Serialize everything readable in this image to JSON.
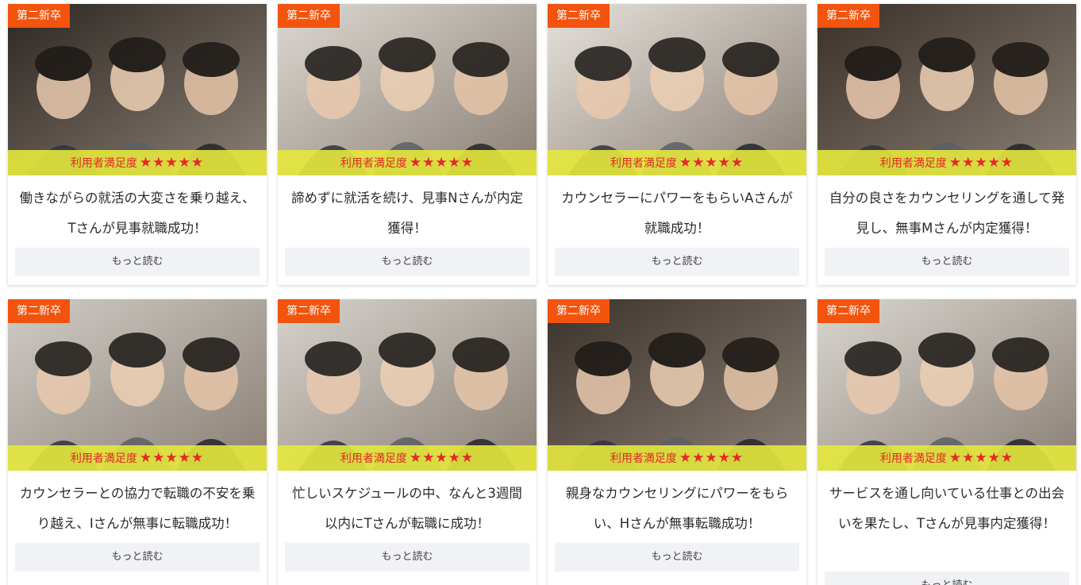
{
  "cards": [
    {
      "badge": "第二新卒",
      "rating_label": "利用者満足度",
      "stars": "★★★★★",
      "title": "働きながらの就活の大変さを乗り越え、Tさんが見事就職成功！",
      "more": "もっと読む",
      "photo_tone": "#2d2722"
    },
    {
      "badge": "第二新卒",
      "rating_label": "利用者満足度",
      "stars": "★★★★★",
      "title": "諦めずに就活を続け、見事Nさんが内定獲得！",
      "more": "もっと読む",
      "photo_tone": "#dcd8d2"
    },
    {
      "badge": "第二新卒",
      "rating_label": "利用者満足度",
      "stars": "★★★★★",
      "title": "カウンセラーにパワーをもらいAさんが就職成功！",
      "more": "もっと読む",
      "photo_tone": "#e6e2dc"
    },
    {
      "badge": "第二新卒",
      "rating_label": "利用者満足度",
      "stars": "★★★★★",
      "title": "自分の良さをカウンセリングを通して発見し、無事Mさんが内定獲得！",
      "more": "もっと読む",
      "photo_tone": "#3a3029"
    },
    {
      "badge": "第二新卒",
      "rating_label": "利用者満足度",
      "stars": "★★★★★",
      "title": "カウンセラーとの協力で転職の不安を乗り越え、Iさんが無事に転職成功！",
      "more": "もっと読む",
      "photo_tone": "#cfccc6"
    },
    {
      "badge": "第二新卒",
      "rating_label": "利用者満足度",
      "stars": "★★★★★",
      "title": "忙しいスケジュールの中、なんと3週間以内にTさんが転職に成功！",
      "more": "もっと読む",
      "photo_tone": "#d6d3cd"
    },
    {
      "badge": "第二新卒",
      "rating_label": "利用者満足度",
      "stars": "★★★★★",
      "title": "親身なカウンセリングにパワーをもらい、Hさんが無事転職成功！",
      "more": "もっと読む",
      "photo_tone": "#3b322b"
    },
    {
      "badge": "第二新卒",
      "rating_label": "利用者満足度",
      "stars": "★★★★★",
      "title": "サービスを通し向いている仕事との出会いを果たし、Tさんが見事内定獲得！",
      "more": "もっと読む",
      "photo_tone": "#d9d6d0"
    }
  ],
  "colors": {
    "badge": "#f2530d",
    "rating_band": "#e4e83c",
    "rating_text": "#e8262b",
    "button_bg": "#f1f2f5"
  }
}
